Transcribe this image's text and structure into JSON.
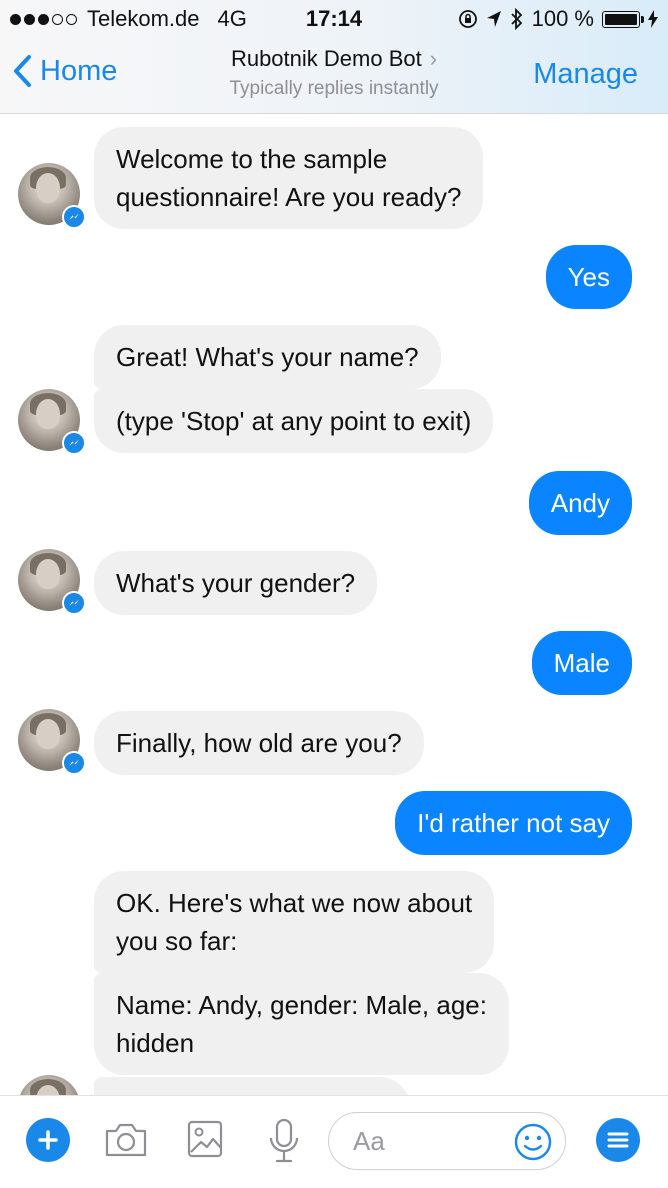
{
  "status_bar": {
    "carrier": "Telekom.de",
    "network": "4G",
    "time": "17:14",
    "battery": "100 %"
  },
  "nav": {
    "back_label": "Home",
    "title": "Rubotnik Demo Bot",
    "subtitle": "Typically replies instantly",
    "manage_label": "Manage"
  },
  "messages": [
    {
      "from": "bot",
      "text_lines": [
        "Welcome to the sample",
        "questionnaire! Are you ready?"
      ]
    },
    {
      "from": "user",
      "text": "Yes"
    },
    {
      "from": "bot",
      "text": "Great! What's your name?"
    },
    {
      "from": "bot",
      "text": "(type 'Stop' at any point to exit)"
    },
    {
      "from": "user",
      "text": "Andy"
    },
    {
      "from": "bot",
      "text": "What's your gender?"
    },
    {
      "from": "user",
      "text": "Male"
    },
    {
      "from": "bot",
      "text": "Finally, how old are you?"
    },
    {
      "from": "user",
      "text": "I'd rather not say"
    },
    {
      "from": "bot",
      "text_lines": [
        "OK. Here's what we now about",
        "you so far:"
      ]
    },
    {
      "from": "bot",
      "text_lines": [
        "Name: Andy, gender: Male, age:",
        "hidden"
      ]
    }
  ],
  "composer": {
    "placeholder": "Aa"
  },
  "colors": {
    "accent": "#1a88e8",
    "outgoing_bubble": "#0a84ff",
    "incoming_bubble": "#f1f0f0"
  },
  "icons": [
    "plus-icon",
    "camera-icon",
    "image-icon",
    "microphone-icon",
    "emoji-icon",
    "menu-icon",
    "messenger-badge-icon",
    "chevron-left-icon",
    "chevron-right-icon"
  ]
}
